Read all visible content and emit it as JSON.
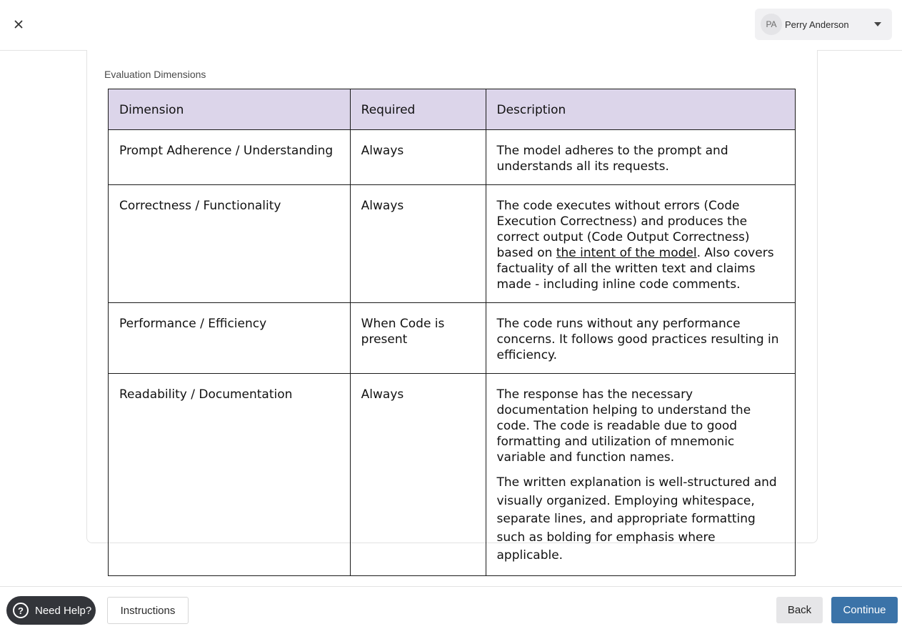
{
  "header": {
    "close_icon": "close-icon",
    "user": {
      "initials": "PA",
      "name": "Perry Anderson",
      "menu_icon": "caret-down-icon"
    }
  },
  "section": {
    "label": "Evaluation Dimensions"
  },
  "table": {
    "headers": [
      "Dimension",
      "Required",
      "Description"
    ],
    "header_bg": "#dcd5ea",
    "rows": [
      {
        "dimension": "Prompt Adherence / Understanding",
        "required": "Always",
        "description": "The model adheres to the prompt and understands all its requests."
      },
      {
        "dimension": "Correctness / Functionality",
        "required": "Always",
        "description_before": "The code executes without errors (Code Execution Correctness) and produces the correct output (Code Output Correctness) based on ",
        "description_link": "the intent of the model",
        "description_after": ". Also covers factuality of all the written text and claims made - including inline code comments."
      },
      {
        "dimension": "Performance / Efficiency",
        "required": "When Code is present",
        "description": "The code runs without any performance concerns. It follows good practices resulting in efficiency."
      },
      {
        "dimension": "Readability / Documentation",
        "required": "Always",
        "description": "The response has the necessary documentation helping to understand the code. The code is readable due to good formatting and utilization of mnemonic variable and function names.",
        "description_extra": "The written explanation is well-structured and visually organized. Employing whitespace, separate lines, and appropriate formatting such as bolding for emphasis where applicable."
      }
    ]
  },
  "footer": {
    "help_label": "Need Help?",
    "help_icon": "question-circle-icon",
    "instructions_label": "Instructions",
    "back_label": "Back",
    "continue_label": "Continue",
    "continue_color": "#3b73a8"
  }
}
